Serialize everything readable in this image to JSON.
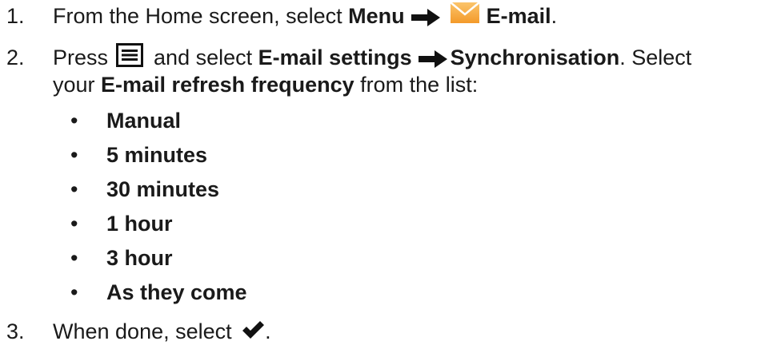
{
  "steps": [
    {
      "number": "1.",
      "text_a": "From the Home screen, select ",
      "menu": "Menu",
      "email": "E-mail",
      "end": "."
    },
    {
      "number": "2.",
      "press": "Press ",
      "and_select": " and select ",
      "email_settings": "E-mail settings",
      "synchronisation": "Synchronisation",
      "select_your": ". Select",
      "your": "your ",
      "refresh": "E-mail refresh frequency",
      "from_list": " from the list:"
    },
    {
      "number": "3.",
      "text_a": "When done, select ",
      "end": "."
    }
  ],
  "options": [
    "Manual",
    "5 minutes",
    "30 minutes",
    "1 hour",
    "3 hour",
    "As they come"
  ],
  "bullet": "•",
  "icons": {
    "arrow": "right-arrow-icon",
    "mail": "mail-envelope-icon",
    "menu": "menu-icon",
    "check": "checkmark-icon"
  },
  "colors": {
    "text": "#1a1a1a",
    "mail_orange": "#f39a2a",
    "mail_light": "#fbc46a"
  }
}
